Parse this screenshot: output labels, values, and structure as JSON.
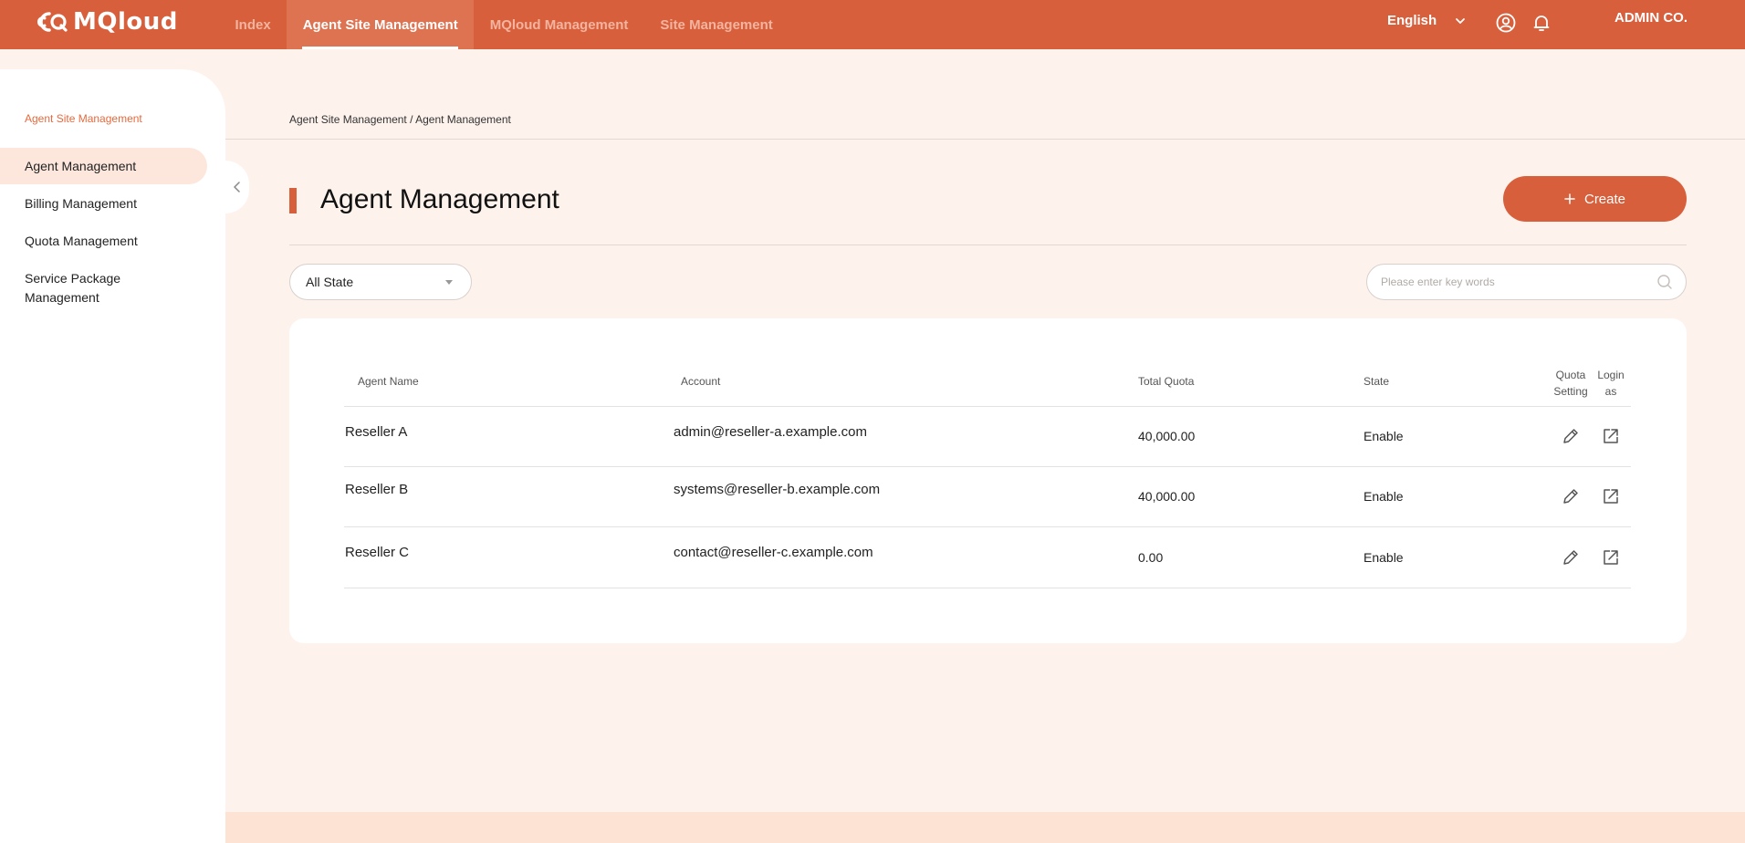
{
  "brand": {
    "name": "MQloud",
    "accent": "#d85f3c"
  },
  "nav": {
    "items": [
      {
        "label": "Index"
      },
      {
        "label": "Agent Site Management"
      },
      {
        "label": "MQloud Management"
      },
      {
        "label": "Site Management"
      }
    ],
    "active": "Agent Site Management"
  },
  "header": {
    "language": "English",
    "company": "ADMIN CO.",
    "icons": [
      "user-icon",
      "bell-icon",
      "chevron-down-icon"
    ]
  },
  "sidebar": {
    "section": "Agent Site Management",
    "items": [
      {
        "label": "Agent Management"
      },
      {
        "label": "Billing Management"
      },
      {
        "label": "Quota Management"
      },
      {
        "label": "Service Package Management"
      }
    ],
    "active": "Agent Management"
  },
  "breadcrumb": "Agent Site Management / Agent Management",
  "page": {
    "title": "Agent Management",
    "create_label": "Create"
  },
  "filters": {
    "state_selected": "All State",
    "search_placeholder": "Please enter key words"
  },
  "table": {
    "headers": {
      "agent_name": "Agent Name",
      "account": "Account",
      "total_quota": "Total Quota",
      "state": "State",
      "quota_setting_1": "Quota",
      "quota_setting_2": "Setting",
      "login_as_1": "Login",
      "login_as_2": "as"
    },
    "rows": [
      {
        "agent_name": "Reseller A",
        "account": "admin@reseller-a.example.com",
        "total_quota": "40,000.00",
        "state": "Enable"
      },
      {
        "agent_name": "Reseller B",
        "account": "systems@reseller-b.example.com",
        "total_quota": "40,000.00",
        "state": "Enable"
      },
      {
        "agent_name": "Reseller C",
        "account": "contact@reseller-c.example.com",
        "total_quota": "0.00",
        "state": "Enable"
      }
    ]
  }
}
